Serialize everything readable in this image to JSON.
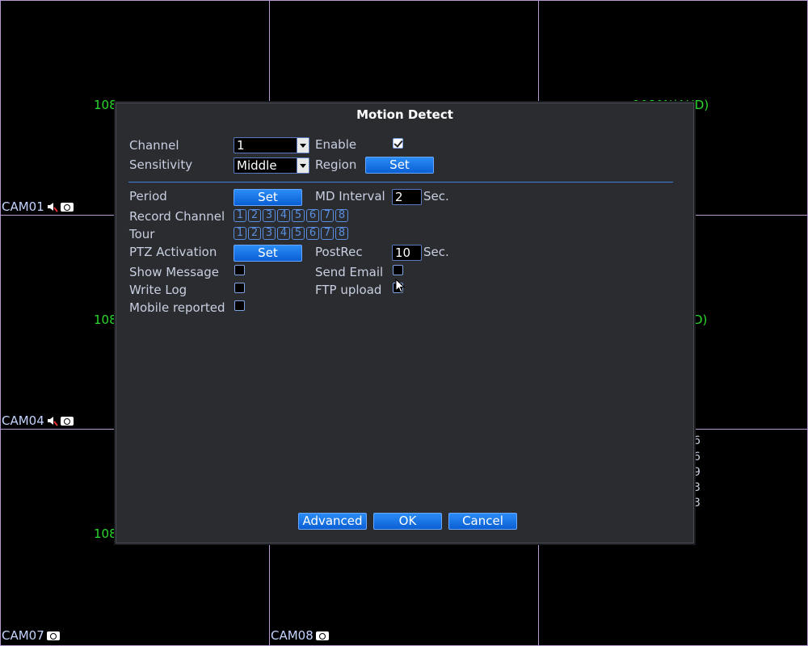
{
  "cameras": [
    {
      "label": "CAM01"
    },
    {
      "label": "CAM04"
    },
    {
      "label": "CAM07"
    },
    {
      "label": "CAM08"
    }
  ],
  "resolution_texts": {
    "r1": "108",
    "r2": "1080N(AHD)",
    "r3": "108",
    "r4": "108",
    "r5": "D)"
  },
  "side_digits": [
    "6",
    "6",
    "9",
    "3",
    "3"
  ],
  "dialog": {
    "title": "Motion Detect",
    "channel": {
      "label": "Channel",
      "value": "1"
    },
    "enable": {
      "label": "Enable",
      "checked": true
    },
    "sensitivity": {
      "label": "Sensitivity",
      "value": "Middle"
    },
    "region": {
      "label": "Region",
      "button": "Set"
    },
    "period": {
      "label": "Period",
      "button": "Set"
    },
    "md_interval": {
      "label": "MD Interval",
      "value": "2",
      "unit": "Sec."
    },
    "record_channel": {
      "label": "Record Channel",
      "channels": [
        "1",
        "2",
        "3",
        "4",
        "5",
        "6",
        "7",
        "8"
      ]
    },
    "tour": {
      "label": "Tour",
      "channels": [
        "1",
        "2",
        "3",
        "4",
        "5",
        "6",
        "7",
        "8"
      ]
    },
    "ptz": {
      "label": "PTZ Activation",
      "button": "Set"
    },
    "postrec": {
      "label": "PostRec",
      "value": "10",
      "unit": "Sec."
    },
    "show_message": {
      "label": "Show Message",
      "checked": false
    },
    "send_email": {
      "label": "Send Email",
      "checked": false
    },
    "write_log": {
      "label": "Write Log",
      "checked": false
    },
    "ftp_upload": {
      "label": "FTP upload",
      "checked": false
    },
    "mobile_reported": {
      "label": "Mobile reported",
      "checked": false
    },
    "buttons": {
      "advanced": "Advanced",
      "ok": "OK",
      "cancel": "Cancel"
    }
  },
  "colors": {
    "accent": "#1a73e8",
    "res_green": "#2bd82b",
    "label": "#c8cfe0"
  }
}
